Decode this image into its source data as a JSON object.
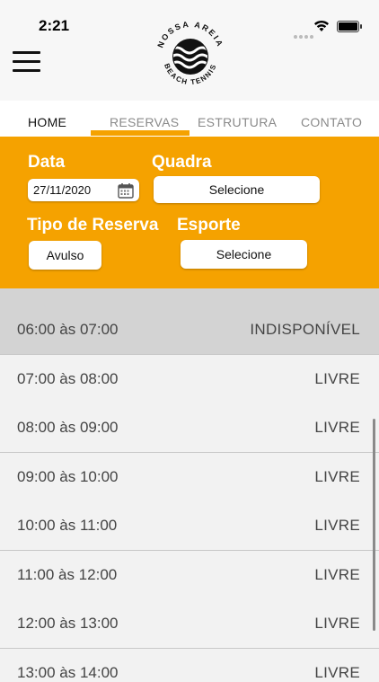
{
  "status_bar": {
    "time": "2:21"
  },
  "header": {
    "logo_text_top": "NOSSA AREIA",
    "logo_text_bottom": "BEACH TENNIS"
  },
  "tabs": [
    {
      "label": "HOME",
      "active": true
    },
    {
      "label": "RESERVAS",
      "active": false
    },
    {
      "label": "ESTRUTURA",
      "active": false
    },
    {
      "label": "CONTATO",
      "active": false
    }
  ],
  "filters": {
    "data_label": "Data",
    "data_value": "27/11/2020",
    "quadra_label": "Quadra",
    "quadra_value": "Selecione",
    "tipo_label": "Tipo de Reserva",
    "tipo_value": "Avulso",
    "esporte_label": "Esporte",
    "esporte_value": "Selecione"
  },
  "slots": [
    {
      "time": "06:00 às 07:00",
      "status": "INDISPONÍVEL"
    },
    {
      "time": "07:00 às 08:00",
      "status": "LIVRE"
    },
    {
      "time": "08:00 às 09:00",
      "status": "LIVRE"
    },
    {
      "time": "09:00 às 10:00",
      "status": "LIVRE"
    },
    {
      "time": "10:00 às 11:00",
      "status": "LIVRE"
    },
    {
      "time": "11:00 às 12:00",
      "status": "LIVRE"
    },
    {
      "time": "12:00 às 13:00",
      "status": "LIVRE"
    },
    {
      "time": "13:00 às 14:00",
      "status": "LIVRE"
    }
  ],
  "colors": {
    "accent": "#f5a200",
    "unavailable_row": "#d3d3d3",
    "row": "#f2f2f2"
  }
}
